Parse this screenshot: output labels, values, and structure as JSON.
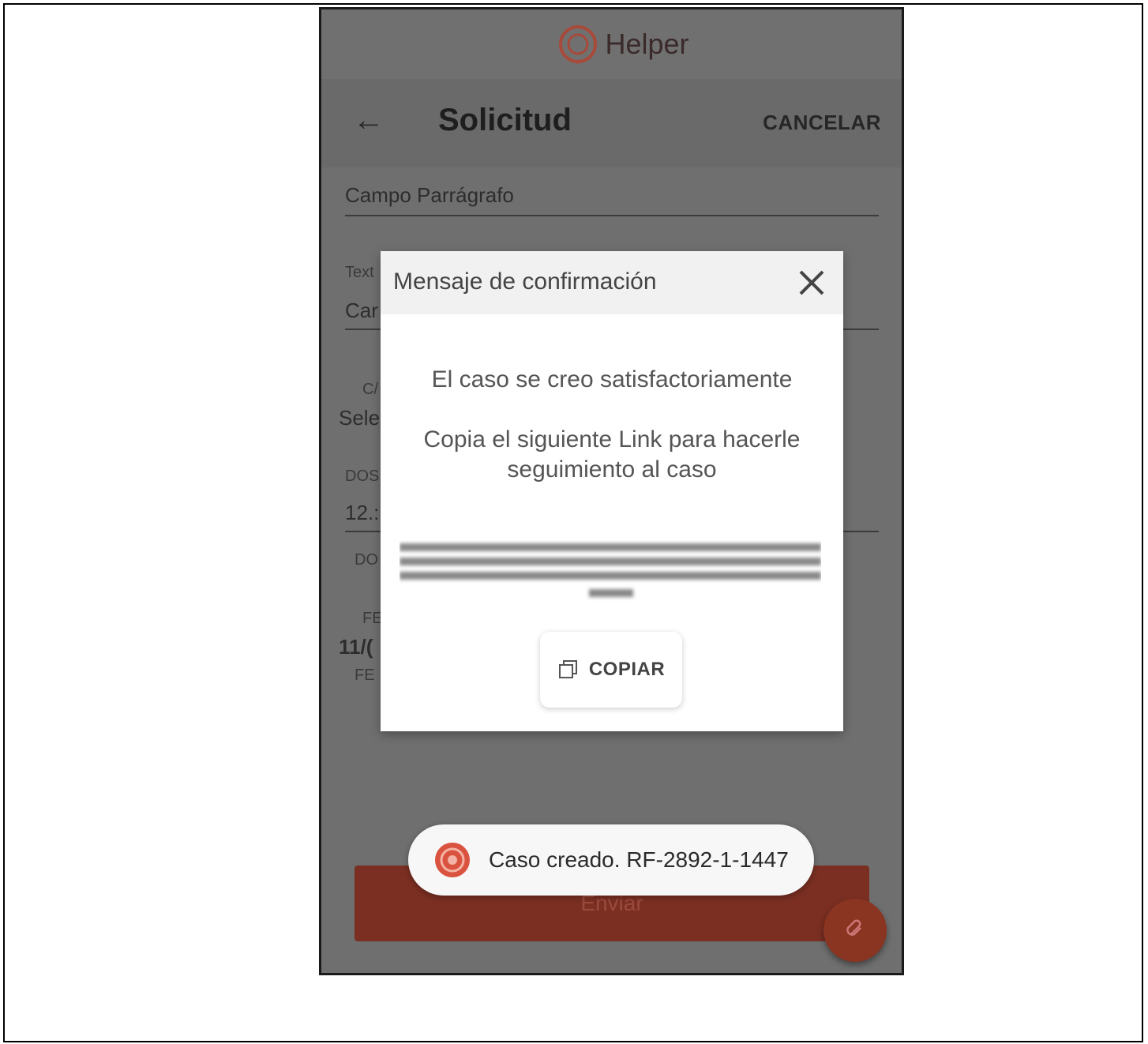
{
  "app": {
    "brand_name": "Helper"
  },
  "toolbar": {
    "back_icon": "arrow-left-icon",
    "title": "Solicitud",
    "cancel_label": "CANCELAR"
  },
  "form_background": {
    "field1_label": "Campo Parrágrafo",
    "text_label_partial": "Text",
    "text_value_partial": "Car",
    "select_label_partial": "C/",
    "select_value_partial": "Sele",
    "dos_label_partial": "DOS",
    "dos_value_partial": "12.:",
    "do_label_partial": "DO",
    "fe_label_partial": "FE",
    "date_value_partial": "11/(",
    "fe_label2_partial": "FE",
    "send_label": "Enviar"
  },
  "modal": {
    "title": "Mensaje de confirmación",
    "message": "El caso se creo satisfactoriamente",
    "instruction": "Copia el siguiente Link para hacerle seguimiento al caso",
    "copy_label": "COPIAR"
  },
  "toast": {
    "text": "Caso creado. RF-2892-1-1447"
  },
  "colors": {
    "accent": "#d9533f",
    "send_button": "#7a2f22"
  }
}
